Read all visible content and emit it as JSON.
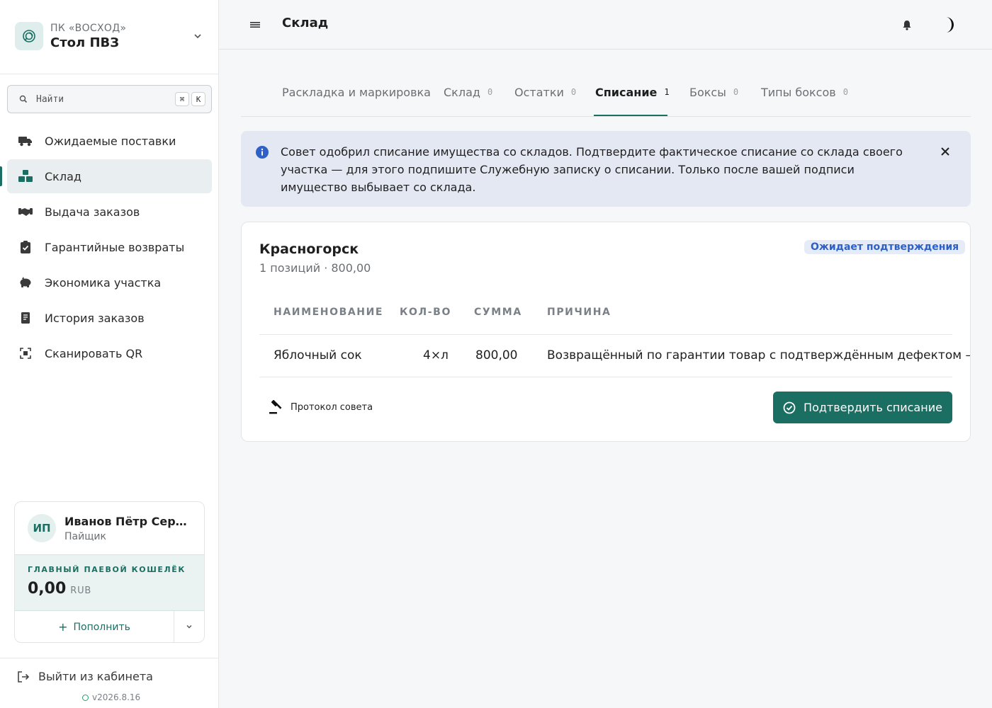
{
  "org": {
    "subtitle": "ПК «ВОСХОД»",
    "title": "Стол ПВЗ"
  },
  "search": {
    "label": "Найти",
    "kbd": [
      "⌘",
      "K"
    ]
  },
  "nav": [
    {
      "label": "Ожидаемые поставки",
      "icon": "truck-icon",
      "active": false
    },
    {
      "label": "Склад",
      "icon": "boxes-icon",
      "active": true
    },
    {
      "label": "Выдача заказов",
      "icon": "handshake-icon",
      "active": false
    },
    {
      "label": "Гарантийные возвраты",
      "icon": "clipboard-check-icon",
      "active": false
    },
    {
      "label": "Экономика участка",
      "icon": "piggy-bank-icon",
      "active": false
    },
    {
      "label": "История заказов",
      "icon": "receipt-icon",
      "active": false
    },
    {
      "label": "Сканировать QR",
      "icon": "qr-scan-icon",
      "active": false
    }
  ],
  "user": {
    "initials": "ИП",
    "name": "Иванов Пётр Сергеевич",
    "role": "Пайщик",
    "wallet_label": "ГЛАВНЫЙ ПАЕВОЙ КОШЕЛЁК",
    "balance": "0,00",
    "currency": "RUB",
    "topup_label": "Пополнить"
  },
  "logout_label": "Выйти из кабинета",
  "version": "v2026.8.16",
  "topbar": {
    "title": "Склад"
  },
  "tabs": [
    {
      "label": "Раскладка и маркировка",
      "count": ""
    },
    {
      "label": "Склад",
      "count": "0"
    },
    {
      "label": "Остатки",
      "count": "0"
    },
    {
      "label": "Списание",
      "count": "1",
      "active": true
    },
    {
      "label": "Боксы",
      "count": "0"
    },
    {
      "label": "Типы боксов",
      "count": "0"
    }
  ],
  "alert": {
    "text": "Совет одобрил списание имущества со складов. Подтвердите фактическое списание со склада своего участка — для этого подпишите Служебную записку о списании. Только после вашей подписи имущество выбывает со склада."
  },
  "card": {
    "title": "Красногорск",
    "subtitle": "1 позиций · 800,00",
    "status": "Ожидает подтверждения",
    "columns": [
      "НАИМЕНОВАНИЕ",
      "КОЛ-ВО",
      "СУММА",
      "ПРИЧИНА"
    ],
    "rows": [
      {
        "name": "Яблочный сок",
        "qty": "4×л",
        "sum": "800,00",
        "reason": "Возвращённый по гарантии товар с подтверждённым дефектом —"
      }
    ],
    "protocol_label": "Протокол совета",
    "confirm_label": "Подтвердить списание"
  },
  "colors": {
    "accent": "#1b6e62",
    "badge_text": "#2e60c8",
    "alert_bg": "#e4e8f3",
    "info": "#2e60c8"
  }
}
